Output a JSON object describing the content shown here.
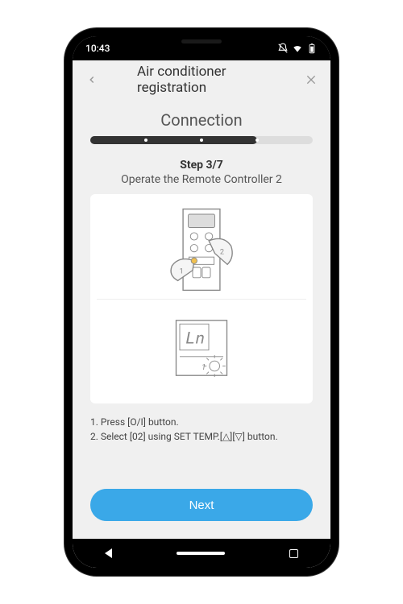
{
  "status": {
    "time": "10:43"
  },
  "header": {
    "title": "Air conditioner registration"
  },
  "section": {
    "title": "Connection"
  },
  "step": {
    "number": "Step 3/7",
    "subtitle": "Operate the Remote Controller 2"
  },
  "instructions": {
    "line1": "1. Press [O/I] button.",
    "line2": "2. Select [02] using SET TEMP.[△][▽] button."
  },
  "button": {
    "next": "Next"
  },
  "progress": {
    "current": 3,
    "total": 7
  }
}
